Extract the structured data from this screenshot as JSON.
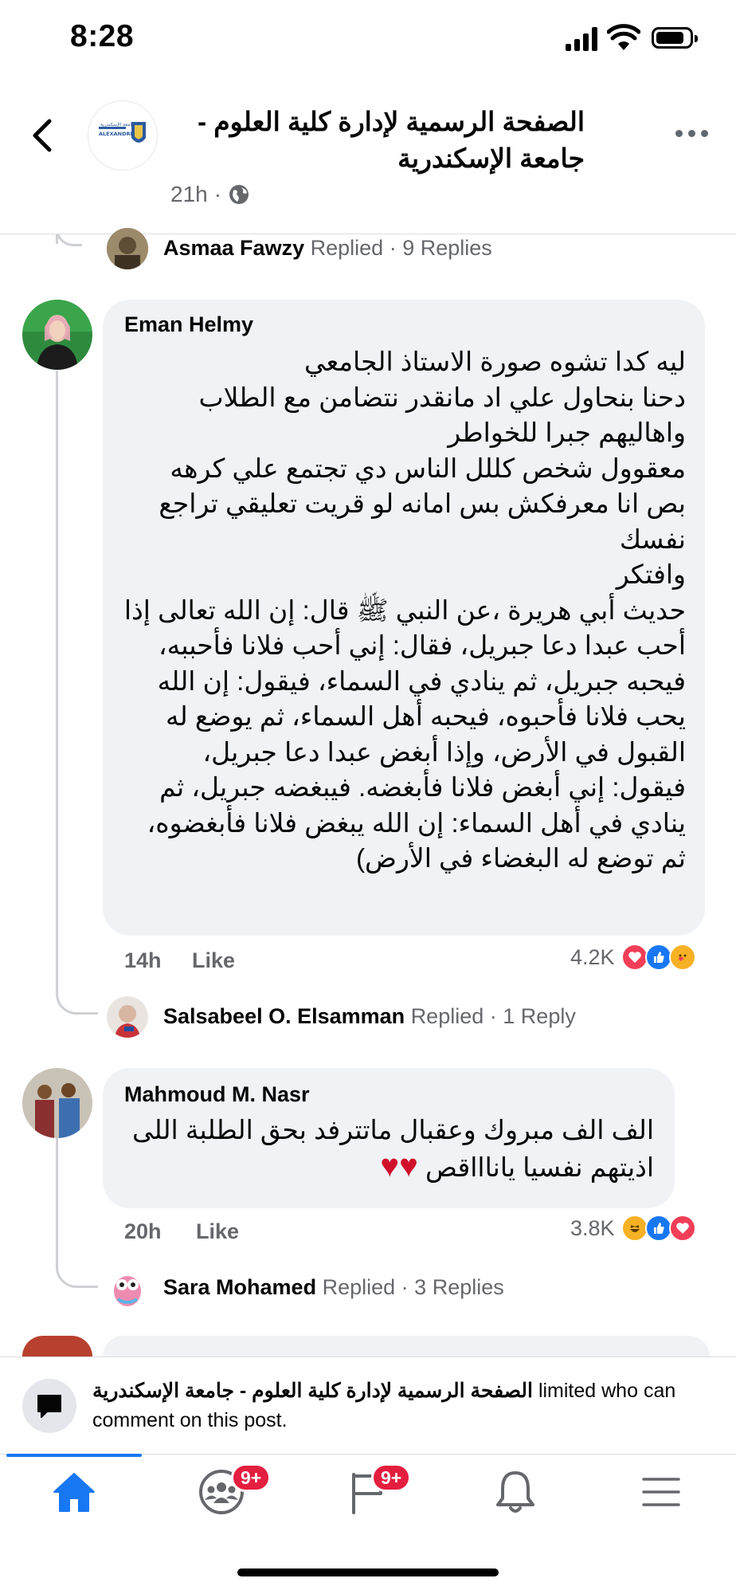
{
  "status_bar": {
    "time": "8:28"
  },
  "header": {
    "page_name": "الصفحة الرسمية لإدارة كلية العلوم - جامعة الإسكندرية",
    "time": "21h",
    "privacy_sep": "·",
    "logo_text": "ALEXANDRIA"
  },
  "thread": [
    {
      "type": "reply_summary",
      "name": "Asmaa Fawzy",
      "action": "Replied",
      "sep": "·",
      "count": "9 Replies"
    },
    {
      "type": "comment",
      "author": "Eman Helmy",
      "lines": [
        "ليه كدا تشوه صورة الاستاذ الجامعي",
        "دحنا بنحاول علي اد مانقدر نتضامن مع الطلاب",
        "واهاليهم جبرا للخواطر",
        "معقوول شخص كللل الناس دي تجتمع علي كرهه",
        "بص انا معرفكش بس امانه لو قريت تعليقي تراجع",
        "نفسك",
        "وافتكر",
        "حديث أبي هريرة ،عن النبي ﷺ قال: إن الله تعالى إذا",
        "أحب عبدا دعا جبريل، فقال: إني أحب فلانا فأحببه،",
        "فيحبه جبريل، ثم ينادي في السماء، فيقول: إن الله",
        "يحب فلانا فأحبوه، فيحبه أهل السماء، ثم يوضع له",
        "القبول في الأرض، وإذا أبغض عبدا دعا جبريل،",
        "فيقول: إني أبغض فلانا فأبغضه. فيبغضه جبريل، ثم",
        "ينادي في أهل السماء: إن الله يبغض فلانا فأبغضوه،",
        "ثم توضع له البغضاء في الأرض)"
      ],
      "time": "14h",
      "like_label": "Like",
      "reaction_count": "4.2K",
      "reactions": [
        "love",
        "like",
        "care"
      ]
    },
    {
      "type": "reply_summary",
      "name": "Salsabeel O. Elsamman",
      "action": "Replied",
      "sep": "·",
      "count": "1 Reply"
    },
    {
      "type": "comment",
      "author": "Mahmoud M. Nasr",
      "lines": [
        "الف الف مبروك وعقبال ماتترفد بحق الطلبة اللى",
        "اذيتهم نفسيا ياناااقص ♥♥"
      ],
      "time": "20h",
      "like_label": "Like",
      "reaction_count": "3.8K",
      "reactions": [
        "haha",
        "like",
        "love"
      ]
    },
    {
      "type": "reply_summary",
      "name": "Sara Mohamed",
      "action": "Replied",
      "sep": "·",
      "count": "3 Replies"
    }
  ],
  "limited_banner": {
    "page_name": "الصفحة الرسمية لإدارة كلية العلوم - جامعة الإسكندرية",
    "message_1": " limited who can",
    "message_2": "comment on this post."
  },
  "bottom_nav": {
    "items": [
      "home",
      "groups",
      "feeds",
      "notifications",
      "menu"
    ],
    "groups_badge": "9+",
    "feeds_badge": "9+"
  },
  "colors": {
    "accent": "#1877f2",
    "badge": "#e41e3f",
    "bubble": "#f0f2f5",
    "secondary_text": "#65676b"
  }
}
